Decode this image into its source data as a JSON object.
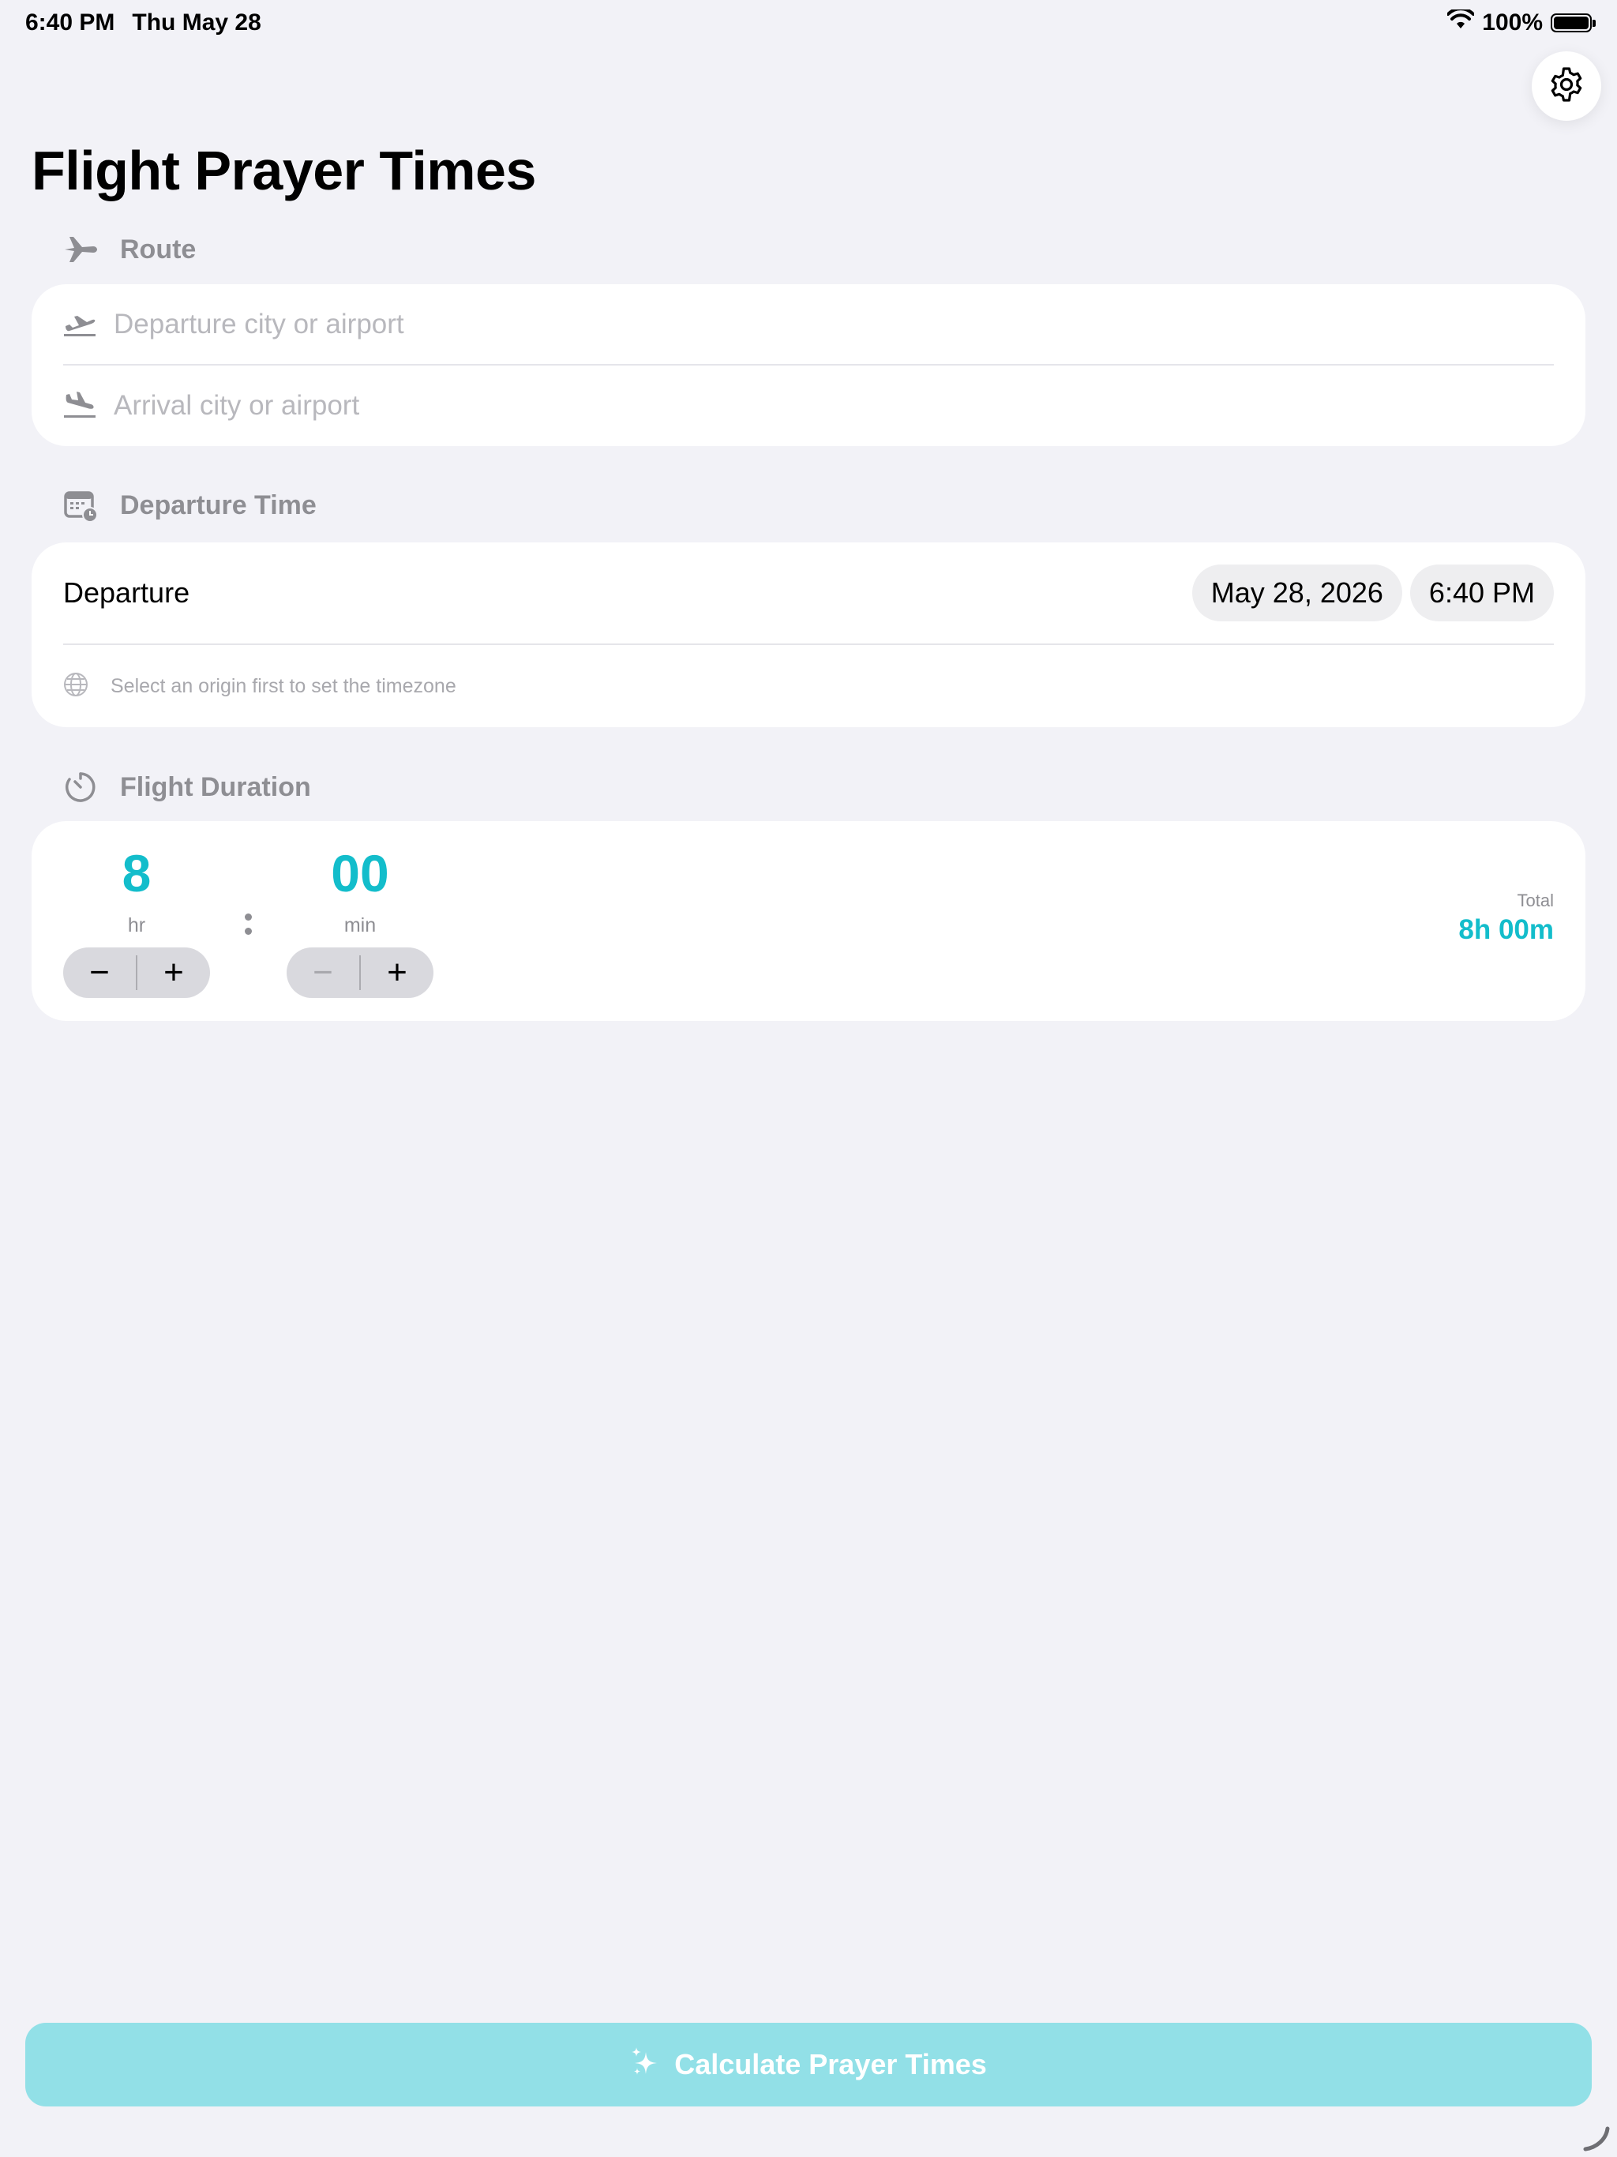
{
  "status_bar": {
    "time": "6:40 PM",
    "date": "Thu May 28",
    "battery": "100%",
    "battery_level": 1.0
  },
  "page": {
    "title": "Flight Prayer Times"
  },
  "route": {
    "header": "Route",
    "departure_placeholder": "Departure city or airport",
    "arrival_placeholder": "Arrival city or airport"
  },
  "departure_time": {
    "header": "Departure Time",
    "label": "Departure",
    "date": "May 28, 2026",
    "time": "6:40 PM",
    "timezone_hint": "Select an origin first to set the timezone"
  },
  "flight_duration": {
    "header": "Flight Duration",
    "hours": "8",
    "hours_unit": "hr",
    "minutes": "00",
    "minutes_unit": "min",
    "total_label": "Total",
    "total_value": "8h 00m",
    "minus": "−",
    "plus": "+"
  },
  "action": {
    "calculate_label": "Calculate Prayer Times"
  },
  "colors": {
    "accent": "#13BDCB",
    "accent_disabled": "#92E0E7",
    "background": "#F2F2F7",
    "secondary_text": "#8E8E93"
  },
  "icons": [
    "wifi-icon",
    "battery-icon",
    "gear-icon",
    "airplane-icon",
    "takeoff-icon",
    "landing-icon",
    "calendar-clock-icon",
    "globe-icon",
    "timer-icon",
    "sparkles-icon"
  ]
}
